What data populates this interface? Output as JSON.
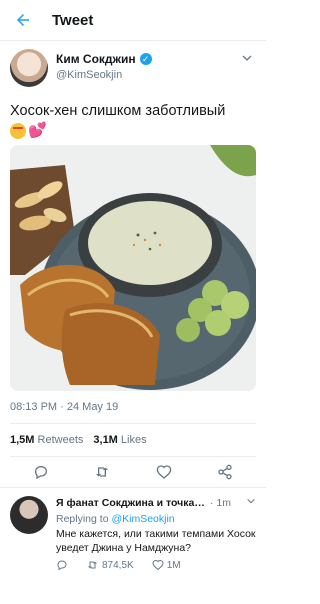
{
  "header": {
    "title": "Tweet"
  },
  "tweet": {
    "author_name": "Ким Сокджин",
    "handle": "@KimSeokjin",
    "text": "Хосок-хен слишком заботливый",
    "time": "08:13 PM · 24 May 19",
    "retweets_count": "1,5M",
    "retweets_label": "Retweets",
    "likes_count": "3,1M",
    "likes_label": "Likes"
  },
  "reply": {
    "author_name": "Я фанат Сокджина и точка ...",
    "time": "· 1m",
    "replying_prefix": "Replying to",
    "replying_to": "@KimSeokjin",
    "text": "Мне кажется, или такими темпами Хосок уведет Джина у Намджуна?",
    "retweets": "874,5K",
    "likes": "1M"
  },
  "colors": {
    "accent": "#1da1f2",
    "text": "#14171a",
    "muted": "#657786",
    "heart": "#e0245e"
  },
  "icons": {
    "back": "arrow-left-icon",
    "verified": "verified-badge-icon",
    "more": "chevron-down-icon",
    "reply": "reply-icon",
    "retweet": "retweet-icon",
    "like": "heart-icon",
    "share": "share-icon"
  }
}
